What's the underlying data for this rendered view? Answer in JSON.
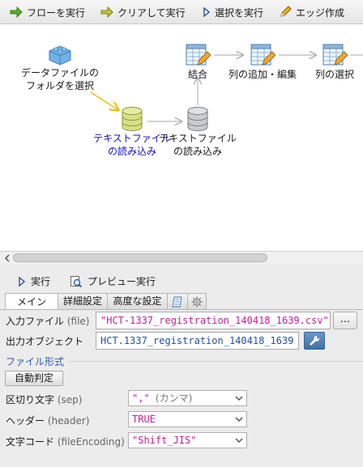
{
  "toolbar": {
    "run_flow": "フローを実行",
    "clear_run": "クリアして実行",
    "run_selected": "選択を実行",
    "create_edge": "エッジ作成"
  },
  "flow": {
    "nodes": [
      {
        "id": "folder",
        "icon": "blocks-icon",
        "line1": "データファイルの",
        "line2": "フォルダを選択"
      },
      {
        "id": "read1",
        "icon": "database-icon",
        "line1": "テキストファイル",
        "line2": "の読み込み",
        "selected": true
      },
      {
        "id": "read2",
        "icon": "database-icon",
        "line1": "テキストファイル",
        "line2": "の読み込み"
      },
      {
        "id": "join",
        "icon": "table-edit-icon",
        "line1": "結合",
        "line2": ""
      },
      {
        "id": "addcol",
        "icon": "table-edit-icon",
        "line1": "列の追加・編集",
        "line2": ""
      },
      {
        "id": "selcol",
        "icon": "table-edit-icon",
        "line1": "列の選択",
        "line2": ""
      }
    ]
  },
  "actions": {
    "run": "実行",
    "preview": "プレビュー実行"
  },
  "tabs": [
    {
      "label": "メイン",
      "active": true
    },
    {
      "label": "詳細設定",
      "active": false
    },
    {
      "label": "高度な設定",
      "active": false
    }
  ],
  "form": {
    "input_file": {
      "label": "入力ファイル",
      "label_en": "(file)",
      "value": "\"HCT-1337_registration_140418_1639.csv\""
    },
    "browse_label": "...",
    "output_object": {
      "label": "出力オブジェクト",
      "value": "HCT.1337_registration_140418_1639"
    },
    "file_format_section": "ファイル形式",
    "auto_detect": "自動判定",
    "sep": {
      "label": "区切り文字",
      "label_en": "(sep)",
      "value": "\",\"",
      "note": "(カンマ)"
    },
    "header": {
      "label": "ヘッダー",
      "label_en": "(header)",
      "value": "TRUE"
    },
    "encoding": {
      "label": "文字コード",
      "label_en": "(fileEncoding)",
      "value": "\"Shift_JIS\""
    }
  },
  "colors": {
    "selected_label": "#1010c0",
    "string_value": "#c0209a",
    "section_title": "#2a5ca8",
    "highlight_edge": "#e8c010"
  }
}
